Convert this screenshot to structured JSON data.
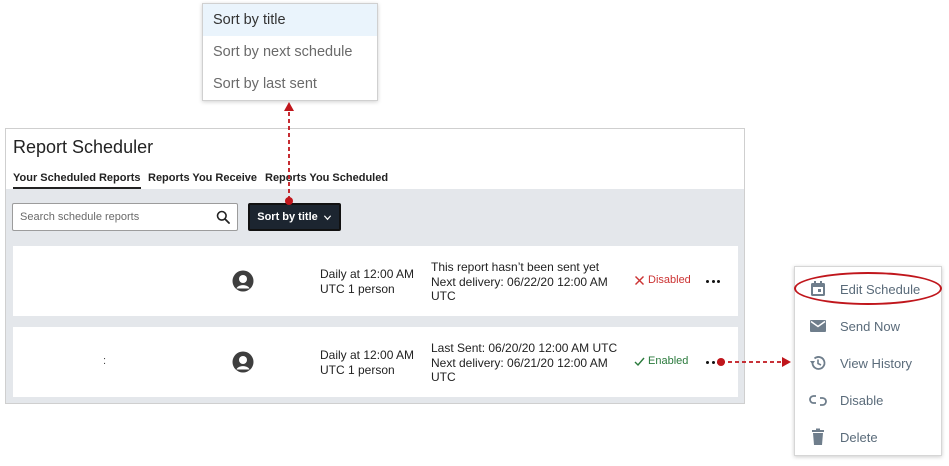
{
  "sort_menu": {
    "items": [
      {
        "label": "Sort by title",
        "selected": true
      },
      {
        "label": "Sort by next schedule",
        "selected": false
      },
      {
        "label": "Sort by last sent",
        "selected": false
      }
    ]
  },
  "panel": {
    "title": "Report Scheduler",
    "tabs": [
      {
        "label": "Your Scheduled Reports",
        "active": true
      },
      {
        "label": "Reports You Receive",
        "active": false
      },
      {
        "label": "Reports You Scheduled",
        "active": false
      }
    ],
    "search": {
      "placeholder": "Search schedule reports",
      "icon": "search-icon"
    },
    "sort_button": {
      "label": "Sort by title",
      "icon": "chevron-down-icon"
    },
    "rows": [
      {
        "title": "",
        "schedule_line1": "Daily at 12:00 AM",
        "schedule_line2": "UTC 1 person",
        "detail_line1": "This report hasn’t been sent yet",
        "detail_line2": "Next delivery: 06/22/20 12:00 AM",
        "detail_line3": "UTC",
        "status": "Disabled",
        "status_icon": "x-icon"
      },
      {
        "title": ":",
        "schedule_line1": "Daily at 12:00 AM",
        "schedule_line2": "UTC 1 person",
        "detail_line1": "Last Sent: 06/20/20 12:00 AM UTC",
        "detail_line2": "Next delivery: 06/21/20 12:00 AM",
        "detail_line3": "UTC",
        "status": "Enabled",
        "status_icon": "check-icon"
      }
    ]
  },
  "actions_menu": {
    "items": [
      {
        "label": "Edit Schedule",
        "icon": "calendar-icon"
      },
      {
        "label": "Send Now",
        "icon": "envelope-icon"
      },
      {
        "label": "View History",
        "icon": "history-icon"
      },
      {
        "label": "Disable",
        "icon": "unlink-icon"
      },
      {
        "label": "Delete",
        "icon": "trash-icon"
      }
    ]
  },
  "colors": {
    "sort_button_bg": "#1c2530",
    "toolbar_bg": "#e4e7eb",
    "annotation_red": "#c0161c",
    "disabled_red": "#cc3333",
    "enabled_green": "#2a7a3c",
    "menu_text": "#5a6b7a",
    "selected_bg": "#eaf4fc"
  }
}
